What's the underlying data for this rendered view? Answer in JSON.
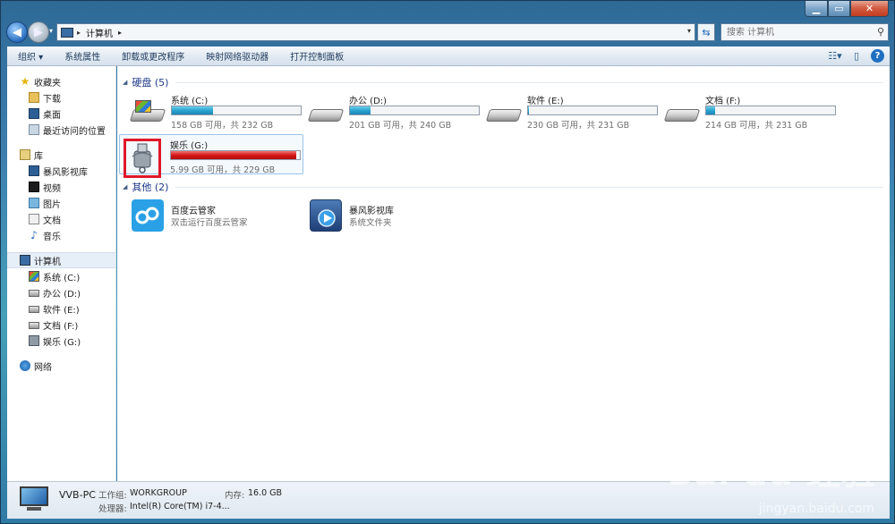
{
  "window": {
    "caption": {
      "min": "▁",
      "max": "▭",
      "close": "✕"
    }
  },
  "nav": {
    "breadcrumb": [
      "计算机"
    ],
    "search_placeholder": "搜索 计算机"
  },
  "toolbar": {
    "organize": "组织 ▾",
    "system_properties": "系统属性",
    "uninstall": "卸载或更改程序",
    "map_drive": "映射网络驱动器",
    "control_panel": "打开控制面板"
  },
  "sidebar": {
    "favorites": {
      "label": "收藏夹",
      "items": [
        "下载",
        "桌面",
        "最近访问的位置"
      ]
    },
    "libraries": {
      "label": "库",
      "items": [
        "暴风影视库",
        "视频",
        "图片",
        "文档",
        "音乐"
      ]
    },
    "computer": {
      "label": "计算机",
      "items": [
        "系统 (C:)",
        "办公 (D:)",
        "软件 (E:)",
        "文档 (F:)",
        "娱乐 (G:)"
      ]
    },
    "network": {
      "label": "网络"
    }
  },
  "sections": {
    "hdd": "硬盘 (5)",
    "other": "其他 (2)"
  },
  "drives": [
    {
      "name": "系统 (C:)",
      "info": "158 GB 可用，共 232 GB",
      "used_fraction": 0.32
    },
    {
      "name": "办公 (D:)",
      "info": "201 GB 可用，共 240 GB",
      "used_fraction": 0.16
    },
    {
      "name": "软件 (E:)",
      "info": "230 GB 可用，共 231 GB",
      "used_fraction": 0.01
    },
    {
      "name": "文档 (F:)",
      "info": "214 GB 可用，共 231 GB",
      "used_fraction": 0.07
    },
    {
      "name": "娱乐 (G:)",
      "info": "5.99 GB 可用，共 229 GB",
      "used_fraction": 0.97
    }
  ],
  "others": [
    {
      "name": "百度云管家",
      "desc": "双击运行百度云管家"
    },
    {
      "name": "暴风影视库",
      "desc": "系统文件夹"
    }
  ],
  "status": {
    "pc_name": "VVB-PC",
    "workgroup_label": "工作组:",
    "workgroup_value": "WORKGROUP",
    "memory_label": "内存:",
    "memory_value": "16.0 GB",
    "cpu_label": "处理器:",
    "cpu_value": "Intel(R) Core(TM) i7-4..."
  },
  "watermark": {
    "brand": "Bai du 经验",
    "url": "jingyan.baidu.com"
  },
  "colors": {
    "accent": "#1e3a8a",
    "bar_normal": "#2aa4d2",
    "bar_full": "#d61818",
    "highlight_box": "#e0182a"
  }
}
